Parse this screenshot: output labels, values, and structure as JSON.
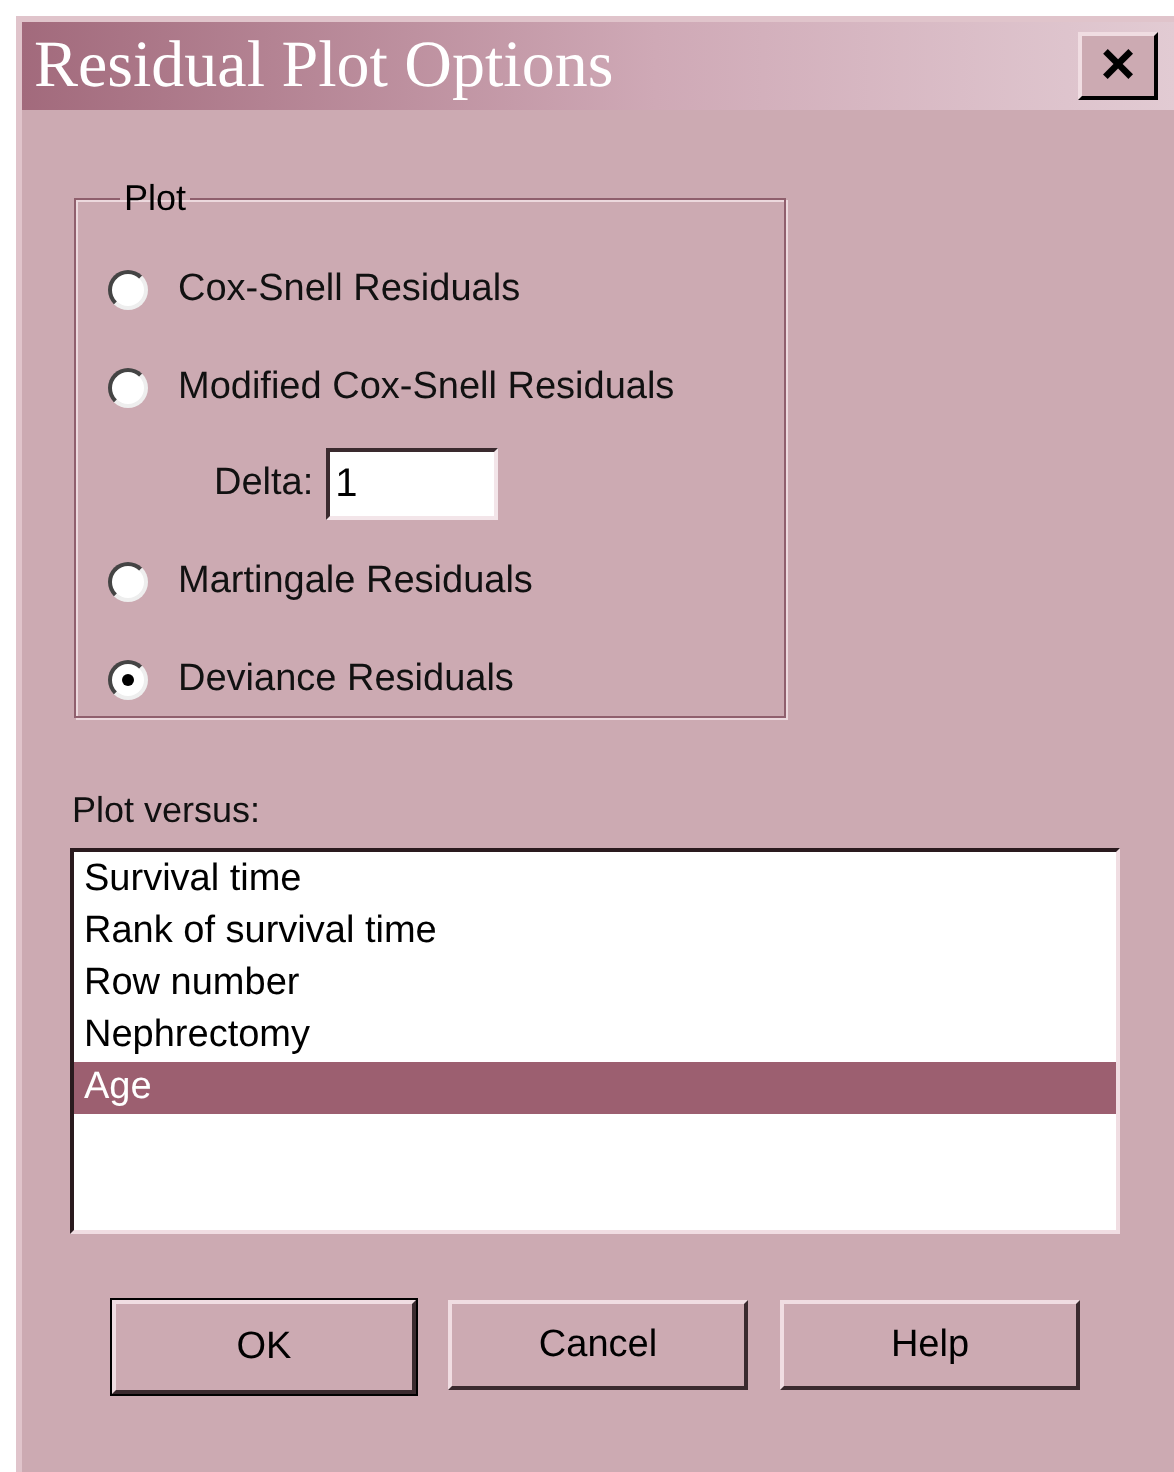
{
  "window": {
    "title": "Residual Plot Options",
    "close": "×"
  },
  "plot_group": {
    "legend": "Plot",
    "options": [
      {
        "label": "Cox-Snell Residuals",
        "selected": false
      },
      {
        "label": "Modified Cox-Snell Residuals",
        "selected": false,
        "delta": {
          "label": "Delta:",
          "value": "1"
        }
      },
      {
        "label": "Martingale Residuals",
        "selected": false
      },
      {
        "label": "Deviance Residuals",
        "selected": true
      }
    ]
  },
  "plot_versus": {
    "label": "Plot versus:",
    "items": [
      {
        "label": "Survival time",
        "selected": false
      },
      {
        "label": "Rank of survival time",
        "selected": false
      },
      {
        "label": "Row number",
        "selected": false
      },
      {
        "label": "Nephrectomy",
        "selected": false
      },
      {
        "label": "Age",
        "selected": true
      }
    ]
  },
  "buttons": [
    {
      "label": "OK",
      "default": true
    },
    {
      "label": "Cancel",
      "default": false
    },
    {
      "label": "Help",
      "default": false
    }
  ]
}
